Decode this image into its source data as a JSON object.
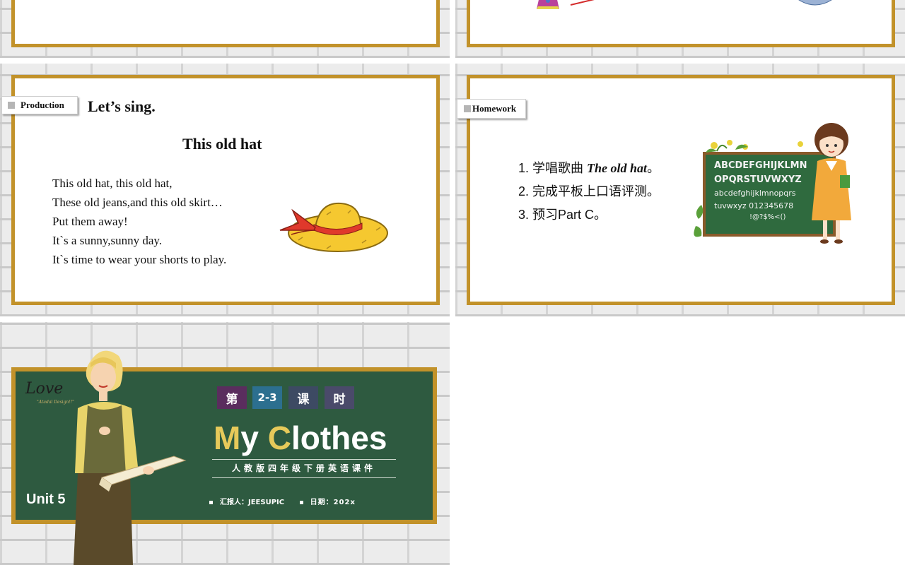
{
  "slide_production": {
    "tag": "Production",
    "heading": "Let’s sing.",
    "song_title": "This old hat",
    "lyrics": [
      "This old hat, this old hat,",
      "These old jeans,and this old skirt…",
      "Put  them away!",
      "It`s a sunny,sunny day.",
      "It`s time to wear your shorts to play."
    ]
  },
  "slide_homework": {
    "tag": "Homework",
    "items": [
      {
        "num": "1.",
        "text": "学唱歌曲 ",
        "italic": "The old hat",
        "suffix": "。"
      },
      {
        "num": "2.",
        "text": "完成平板上口语评测。",
        "italic": "",
        "suffix": ""
      },
      {
        "num": "3.",
        "text": "预习Part C。",
        "italic": "",
        "suffix": ""
      }
    ],
    "board_lines": [
      "ABCDEFGHIJKLMN",
      "OPQRSTUVWXYZ",
      "abcdefghijklmnopqrs",
      "tuvwxyz  012345678",
      "!@?$%<()"
    ]
  },
  "slide_cover": {
    "badges": [
      {
        "text": "第",
        "color": "#5a2d5e"
      },
      {
        "text": "2-3",
        "color": "#2c6f8f"
      },
      {
        "text": "课",
        "color": "#3d4a63"
      },
      {
        "text": "时",
        "color": "#4a4a6a"
      }
    ],
    "title_parts": [
      {
        "text": "M",
        "color": "#e6c95a"
      },
      {
        "text": "y ",
        "color": "#ffffff"
      },
      {
        "text": "C",
        "color": "#e6c95a"
      },
      {
        "text": "lothes",
        "color": "#ffffff"
      }
    ],
    "subtitle": "人教版四年级下册英语课件",
    "reporter": "汇报人：JEESUPIC",
    "date": "日期：202x",
    "unit": "Unit 5",
    "logo_text": "Love",
    "logo_sub": "\"Atadal Design!!\""
  },
  "colors": {
    "frame_gold": "#c2922a",
    "chalkboard_green": "#2e5a40",
    "hat_yellow": "#f5c830",
    "ribbon_red": "#e0392b"
  }
}
